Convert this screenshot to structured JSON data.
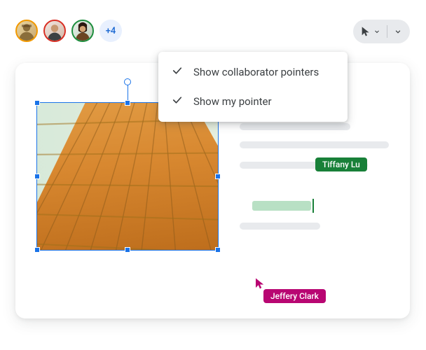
{
  "collaborators": {
    "overflow_label": "+4"
  },
  "pointer_menu": {
    "items": [
      {
        "label": "Show collaborator pointers",
        "checked": true
      },
      {
        "label": "Show my pointer",
        "checked": true
      }
    ]
  },
  "cursors": {
    "tiffany": {
      "name": "Tiffany Lu",
      "color": "#188038"
    },
    "jeffery": {
      "name": "Jeffery Clark",
      "color": "#b80672"
    }
  }
}
